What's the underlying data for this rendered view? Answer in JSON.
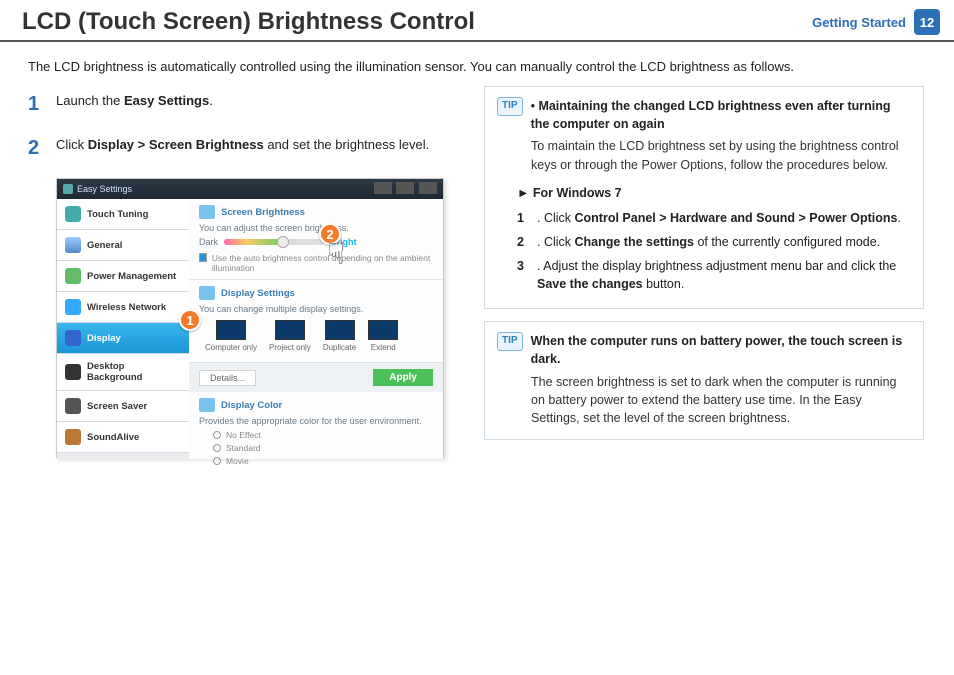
{
  "header": {
    "title": "LCD (Touch Screen) Brightness Control",
    "section": "Getting Started",
    "page_number": "12"
  },
  "intro": "The LCD brightness is automatically controlled using the illumination sensor.  You can manually control the LCD brightness as follows.",
  "steps": {
    "s1_pre": "Launch the ",
    "s1_bold": "Easy Settings",
    "s1_post": ".",
    "s2_pre": "Click ",
    "s2_bold": "Display > Screen Brightness",
    "s2_post": " and set the brightness level."
  },
  "screenshot": {
    "window_title": "Easy Settings",
    "sidebar": {
      "touch_tuning": "Touch Tuning",
      "general": "General",
      "power_management": "Power Management",
      "wireless_network": "Wireless Network",
      "display": "Display",
      "desktop_background": "Desktop Background",
      "screen_saver": "Screen Saver",
      "soundalive": "SoundAlive"
    },
    "panels": {
      "brightness_title": "Screen Brightness",
      "brightness_hint": "You can adjust the screen brightness.",
      "dark_label": "Dark",
      "bright_label": "Bright",
      "auto_check": "Use the auto brightness control depending on the ambient illumination",
      "disp_settings_title": "Display Settings",
      "disp_settings_hint": "You can change multiple display settings.",
      "opt_computer": "Computer only",
      "opt_project": "Project only",
      "opt_duplicate": "Duplicate",
      "opt_extend": "Extend",
      "details_btn": "Details...",
      "apply_btn": "Apply",
      "color_title": "Display Color",
      "color_hint": "Provides the appropriate color for the user environment.",
      "color_no_effect": "No Effect",
      "color_standard": "Standard",
      "color_movie": "Movie"
    },
    "callouts": {
      "c1": "1",
      "c2": "2"
    }
  },
  "tip1": {
    "badge": "TIP",
    "bullet": "•",
    "title": "Maintaining the changed LCD brightness even after turning the computer on again",
    "body": "To maintain the LCD brightness set by using the brightness control keys or through the Power Options, follow the procedures below.",
    "win7_marker": "►",
    "win7_label": "For Windows 7",
    "s1_num": "1",
    "s1_pre": ". Click ",
    "s1_bold": "Control Panel > Hardware and Sound > Power Options",
    "s1_post": ".",
    "s2_num": "2",
    "s2_pre": ". Click ",
    "s2_bold": "Change the settings",
    "s2_post": " of the currently configured mode.",
    "s3_num": "3",
    "s3_pre": ". Adjust the display brightness adjustment menu bar and click the ",
    "s3_bold": "Save the changes",
    "s3_post": " button."
  },
  "tip2": {
    "badge": "TIP",
    "title": "When the computer runs on battery power, the touch screen is dark.",
    "body": "The screen brightness is set to dark when the computer is running on battery power to extend the battery use time. In the Easy Settings, set the level of the screen brightness."
  }
}
